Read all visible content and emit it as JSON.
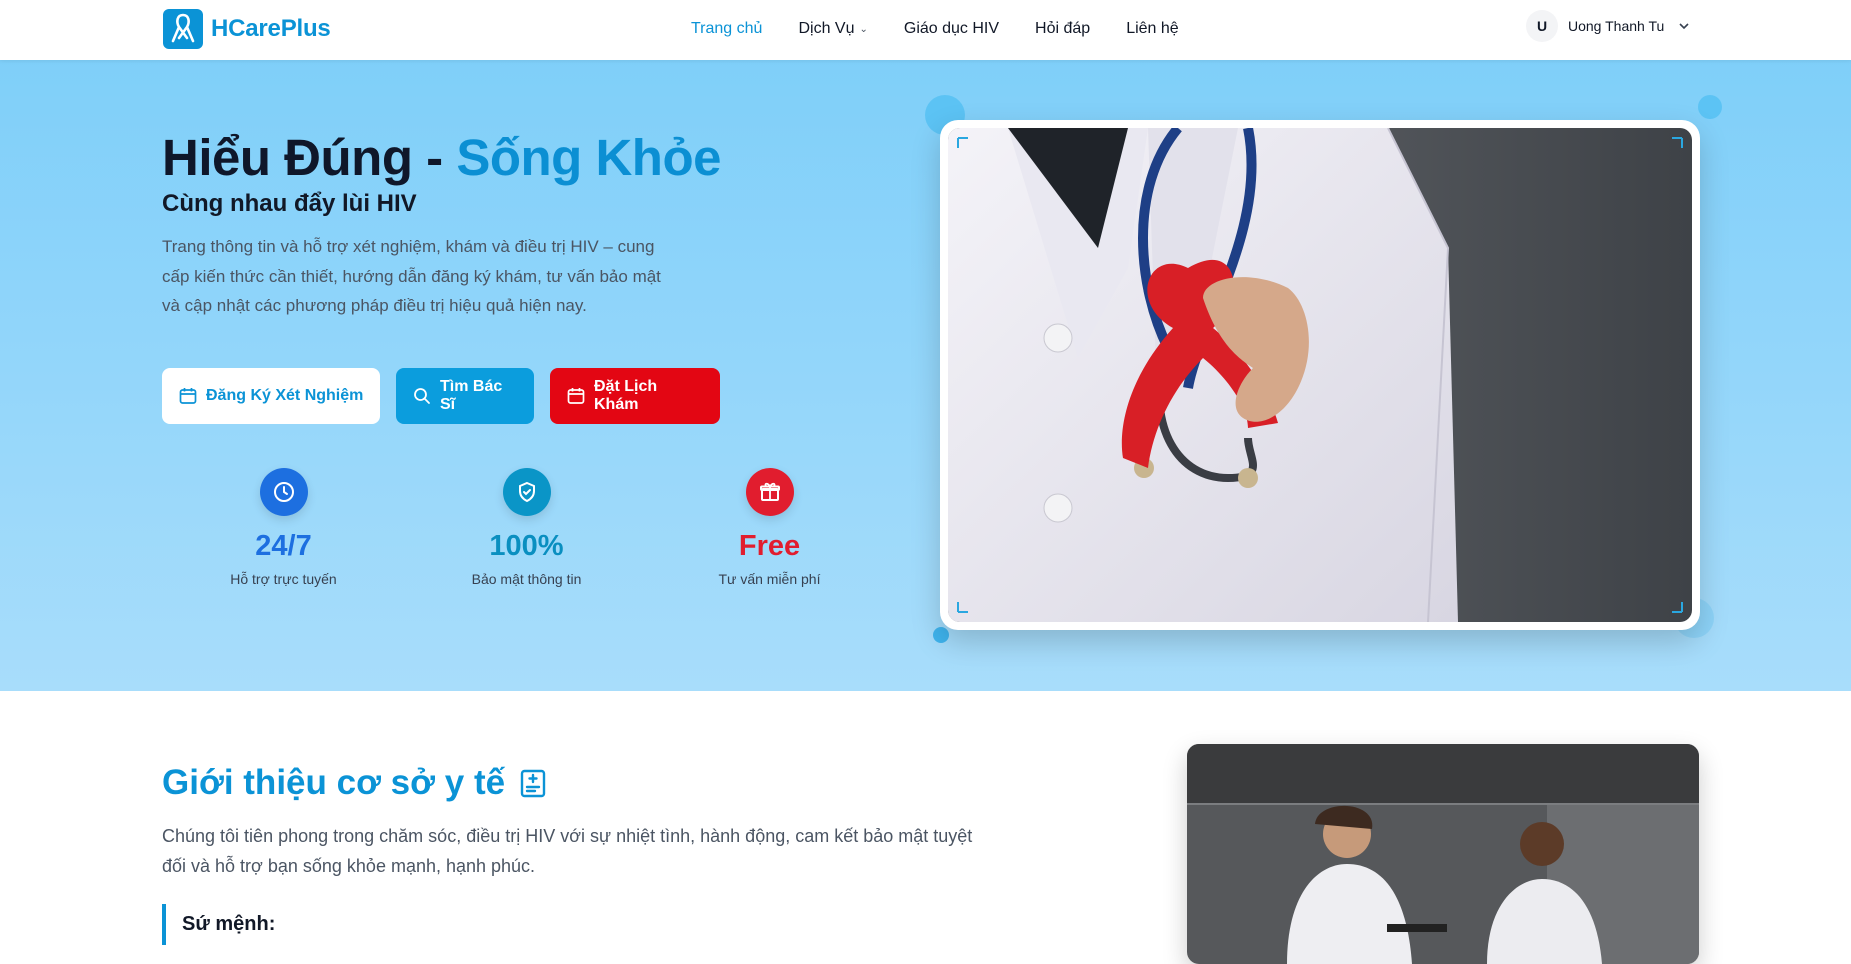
{
  "brand": {
    "name": "HCarePlus"
  },
  "nav": {
    "items": [
      {
        "label": "Trang chủ",
        "active": true
      },
      {
        "label": "Dịch Vụ",
        "has_dropdown": true
      },
      {
        "label": "Giáo dục HIV"
      },
      {
        "label": "Hỏi đáp"
      },
      {
        "label": "Liên hệ"
      }
    ]
  },
  "user": {
    "initial": "U",
    "name": "Uong Thanh Tu"
  },
  "hero": {
    "title_part1": "Hiểu Đúng - ",
    "title_part2": "Sống Khỏe",
    "subtitle": "Cùng nhau đẩy lùi HIV",
    "description": "Trang thông tin và hỗ trợ xét nghiệm, khám và điều trị HIV – cung cấp kiến thức cần thiết, hướng dẫn đăng ký khám, tư vấn bảo mật và cập nhật các phương pháp điều trị hiệu quả hiện nay.",
    "buttons": {
      "register_test": "Đăng Ký Xét Nghiệm",
      "find_doctor": "Tìm Bác Sĩ",
      "book_appointment": "Đặt Lịch Khám"
    },
    "stats": [
      {
        "value": "24/7",
        "label": "Hỗ trợ trực tuyến",
        "icon": "clock-icon",
        "color": "#1d6fe0"
      },
      {
        "value": "100%",
        "label": "Bảo mật thông tin",
        "icon": "shield-check-icon",
        "color": "#0a8fc0"
      },
      {
        "value": "Free",
        "label": "Tư vấn miễn phí",
        "icon": "gift-icon",
        "color": "#e11d2e"
      }
    ]
  },
  "about": {
    "title": "Giới thiệu cơ sở y tế",
    "description": "Chúng tôi tiên phong trong chăm sóc, điều trị HIV với sự nhiệt tình, hành động, cam kết bảo mật tuyệt đối và hỗ trợ bạn sống khỏe mạnh, hạnh phúc.",
    "mission_label": "Sứ mệnh:"
  },
  "colors": {
    "primary": "#0b93d6",
    "red": "#e30613",
    "hero_bg": "#8fd5fa"
  }
}
